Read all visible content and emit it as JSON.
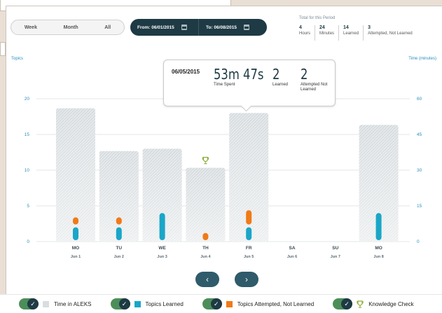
{
  "header": {
    "range_tabs": [
      "Week",
      "Month",
      "All"
    ],
    "from_label": "From: 06/01/2015",
    "to_label": "To: 06/08/2015",
    "totals_title": "Total for this Period",
    "totals": [
      {
        "num": "4",
        "label": "Hours"
      },
      {
        "num": "24",
        "label": "Minutes"
      },
      {
        "num": "14",
        "label": "Learned"
      },
      {
        "num": "3",
        "label": "Attempted, Not Learned"
      }
    ]
  },
  "tooltip": {
    "date": "06/05/2015",
    "time_spent": "53m 47s",
    "time_spent_label": "Time Spent",
    "learned": "2",
    "learned_label": "Learned",
    "attempted": "2",
    "attempted_label": "Attempted Not Learned"
  },
  "chart_data": {
    "type": "bar",
    "left_axis_title": "Topics",
    "right_axis_title": "Time (minutes)",
    "ylim_topics": [
      0,
      20
    ],
    "ylim_time": [
      0,
      60
    ],
    "topic_ticks": [
      0,
      5,
      10,
      15,
      20
    ],
    "time_ticks": [
      0,
      15,
      30,
      45,
      60
    ],
    "days": [
      {
        "day": "MO",
        "date": "Jun 1",
        "time": 56,
        "learned": 2,
        "attempted": 1,
        "check": false
      },
      {
        "day": "TU",
        "date": "Jun 2",
        "time": 38,
        "learned": 2,
        "attempted": 1,
        "check": false
      },
      {
        "day": "WE",
        "date": "Jun 3",
        "time": 39,
        "learned": 4,
        "attempted": 0,
        "check": false
      },
      {
        "day": "TH",
        "date": "Jun 4",
        "time": 31,
        "learned": 0,
        "attempted": 1,
        "check": true
      },
      {
        "day": "FR",
        "date": "Jun 5",
        "time": 54,
        "learned": 2,
        "attempted": 2,
        "check": false
      },
      {
        "day": "SA",
        "date": "Jun 6",
        "time": 0,
        "learned": 0,
        "attempted": 0,
        "check": false
      },
      {
        "day": "SU",
        "date": "Jun 7",
        "time": 0,
        "learned": 0,
        "attempted": 0,
        "check": false
      },
      {
        "day": "MO",
        "date": "Jun 8",
        "time": 49,
        "learned": 4,
        "attempted": 0,
        "check": false
      }
    ]
  },
  "pagination": {
    "prev": "‹",
    "next": "›"
  },
  "legend": {
    "items": [
      {
        "label": "Time in ALEKS",
        "color": "#d7dde0",
        "icon": "gray-square"
      },
      {
        "label": "Topics Learned",
        "color": "#1aa6c8",
        "icon": "teal-square"
      },
      {
        "label": "Topics Attempted, Not Learned",
        "color": "#f07a17",
        "icon": "orange-square"
      },
      {
        "label": "Knowledge Check",
        "color": "#8fae3a",
        "icon": "trophy-icon"
      }
    ],
    "check_glyph": "✓"
  }
}
